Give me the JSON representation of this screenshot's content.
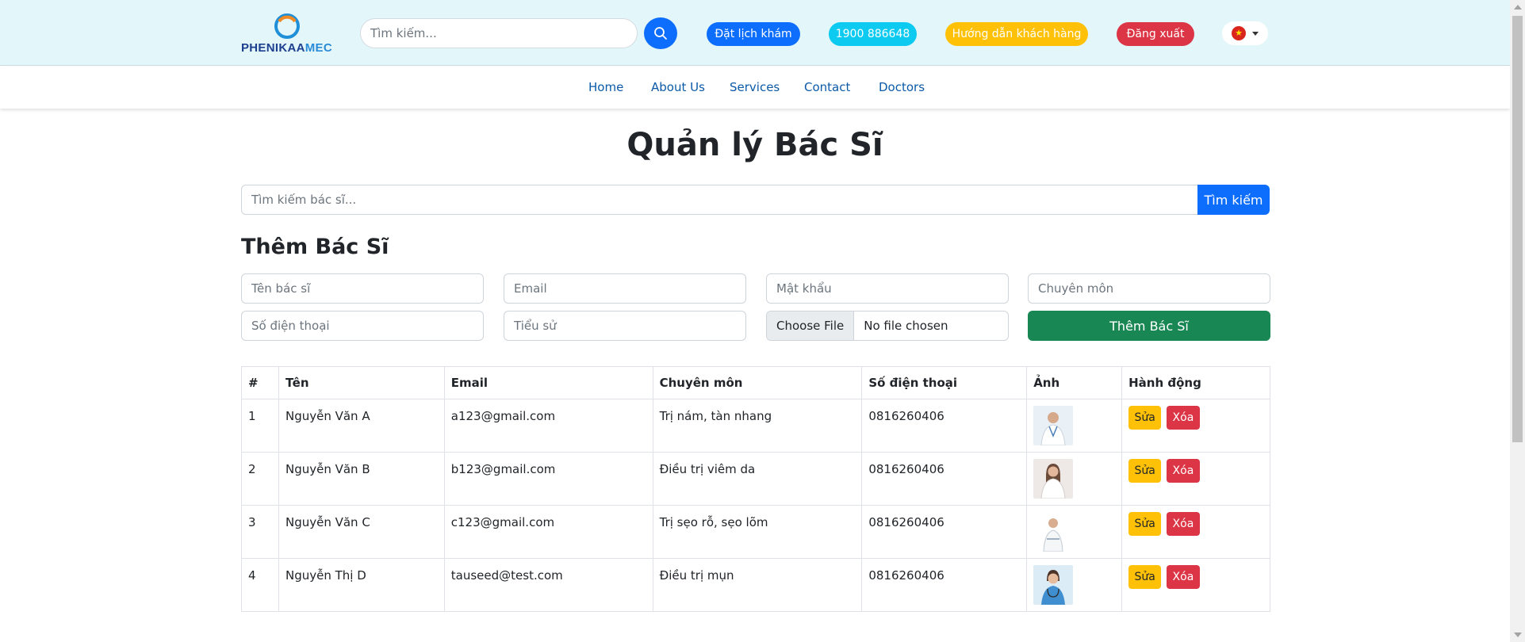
{
  "header": {
    "logo": {
      "text_main": "PHENIKAA",
      "text_accent": "MEC"
    },
    "search": {
      "placeholder": "Tìm kiếm..."
    },
    "buttons": {
      "book": "Đặt lịch khám",
      "phone": "1900 886648",
      "guide": "Hướng dẫn khách hàng",
      "logout": "Đăng xuất"
    },
    "language": {
      "flag_icon": "vietnam-flag-icon"
    }
  },
  "nav": {
    "items": [
      "Home",
      "About Us",
      "Services",
      "Contact",
      "Doctors"
    ]
  },
  "main": {
    "title": "Quản lý Bác Sĩ",
    "search": {
      "placeholder": "Tìm kiếm bác sĩ...",
      "button": "Tìm kiếm"
    },
    "add_section": {
      "title": "Thêm Bác Sĩ",
      "fields": {
        "name": "Tên bác sĩ",
        "email": "Email",
        "password": "Mật khẩu",
        "specialty": "Chuyên môn",
        "phone": "Số điện thoại",
        "bio": "Tiểu sử"
      },
      "file": {
        "button": "Choose File",
        "status": "No file chosen"
      },
      "submit": "Thêm Bác Sĩ"
    },
    "table": {
      "columns": [
        "#",
        "Tên",
        "Email",
        "Chuyên môn",
        "Số điện thoại",
        "Ảnh",
        "Hành động"
      ],
      "rows": [
        {
          "index": "1",
          "name": "Nguyễn Văn A",
          "email": "a123@gmail.com",
          "specialty": "Trị nám, tàn nhang",
          "phone": "0816260406"
        },
        {
          "index": "2",
          "name": "Nguyễn Văn B",
          "email": "b123@gmail.com",
          "specialty": "Điều trị viêm da",
          "phone": "0816260406"
        },
        {
          "index": "3",
          "name": "Nguyễn Văn C",
          "email": "c123@gmail.com",
          "specialty": "Trị sẹo rỗ, sẹo lõm",
          "phone": "0816260406"
        },
        {
          "index": "4",
          "name": "Nguyễn Thị D",
          "email": "tauseed@test.com",
          "specialty": "Điều trị mụn",
          "phone": "0816260406"
        }
      ],
      "actions": {
        "edit": "Sửa",
        "delete": "Xóa"
      }
    }
  },
  "colors": {
    "header_bg": "#e3f6fa",
    "primary": "#0d6efd",
    "info": "#0dcaf0",
    "warning": "#ffc107",
    "danger": "#dc3545",
    "success": "#198754",
    "nav_link": "#0b5aa8"
  }
}
